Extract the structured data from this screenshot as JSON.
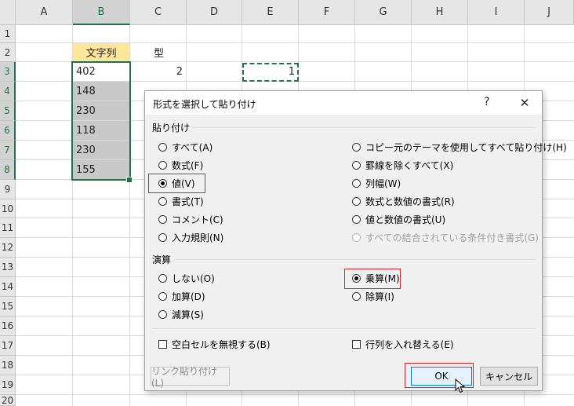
{
  "columns": [
    "A",
    "B",
    "C",
    "D",
    "E",
    "F",
    "G",
    "H",
    "I",
    "J"
  ],
  "rows": [
    "1",
    "2",
    "3",
    "4",
    "5",
    "6",
    "7",
    "8",
    "9",
    "10",
    "11",
    "12",
    "13",
    "14",
    "15",
    "16",
    "17",
    "18",
    "19",
    "20"
  ],
  "cells": {
    "b2": "文字列",
    "c2": "型",
    "b3": "402",
    "b4": "148",
    "b5": "230",
    "b6": "118",
    "b7": "230",
    "b8": "155",
    "c3": "2",
    "e3": "1"
  },
  "dialog": {
    "title": "形式を選択して貼り付け",
    "help": "?",
    "close": "✕",
    "paste_group": "貼り付け",
    "paste_left": [
      "すべて(A)",
      "数式(F)",
      "値(V)",
      "書式(T)",
      "コメント(C)",
      "入力規則(N)"
    ],
    "paste_right": [
      "コピー元のテーマを使用してすべて貼り付け(H)",
      "罫線を除くすべて(X)",
      "列幅(W)",
      "数式と数値の書式(R)",
      "値と数値の書式(U)",
      "すべての結合されている条件付き書式(G)"
    ],
    "paste_selected": "値(V)",
    "operation_group": "演算",
    "operation_left": [
      "しない(O)",
      "加算(D)",
      "減算(S)"
    ],
    "operation_right": [
      "乗算(M)",
      "除算(I)"
    ],
    "operation_selected": "乗算(M)",
    "skip_blanks": "空白セルを無視する(B)",
    "transpose": "行列を入れ替える(E)",
    "paste_link": "リンク貼り付け(L)",
    "ok": "OK",
    "cancel": "キャンセル"
  },
  "colors": {
    "accent": "#217346",
    "highlight_red": "#e0202a",
    "header_fill": "#ffe699"
  }
}
